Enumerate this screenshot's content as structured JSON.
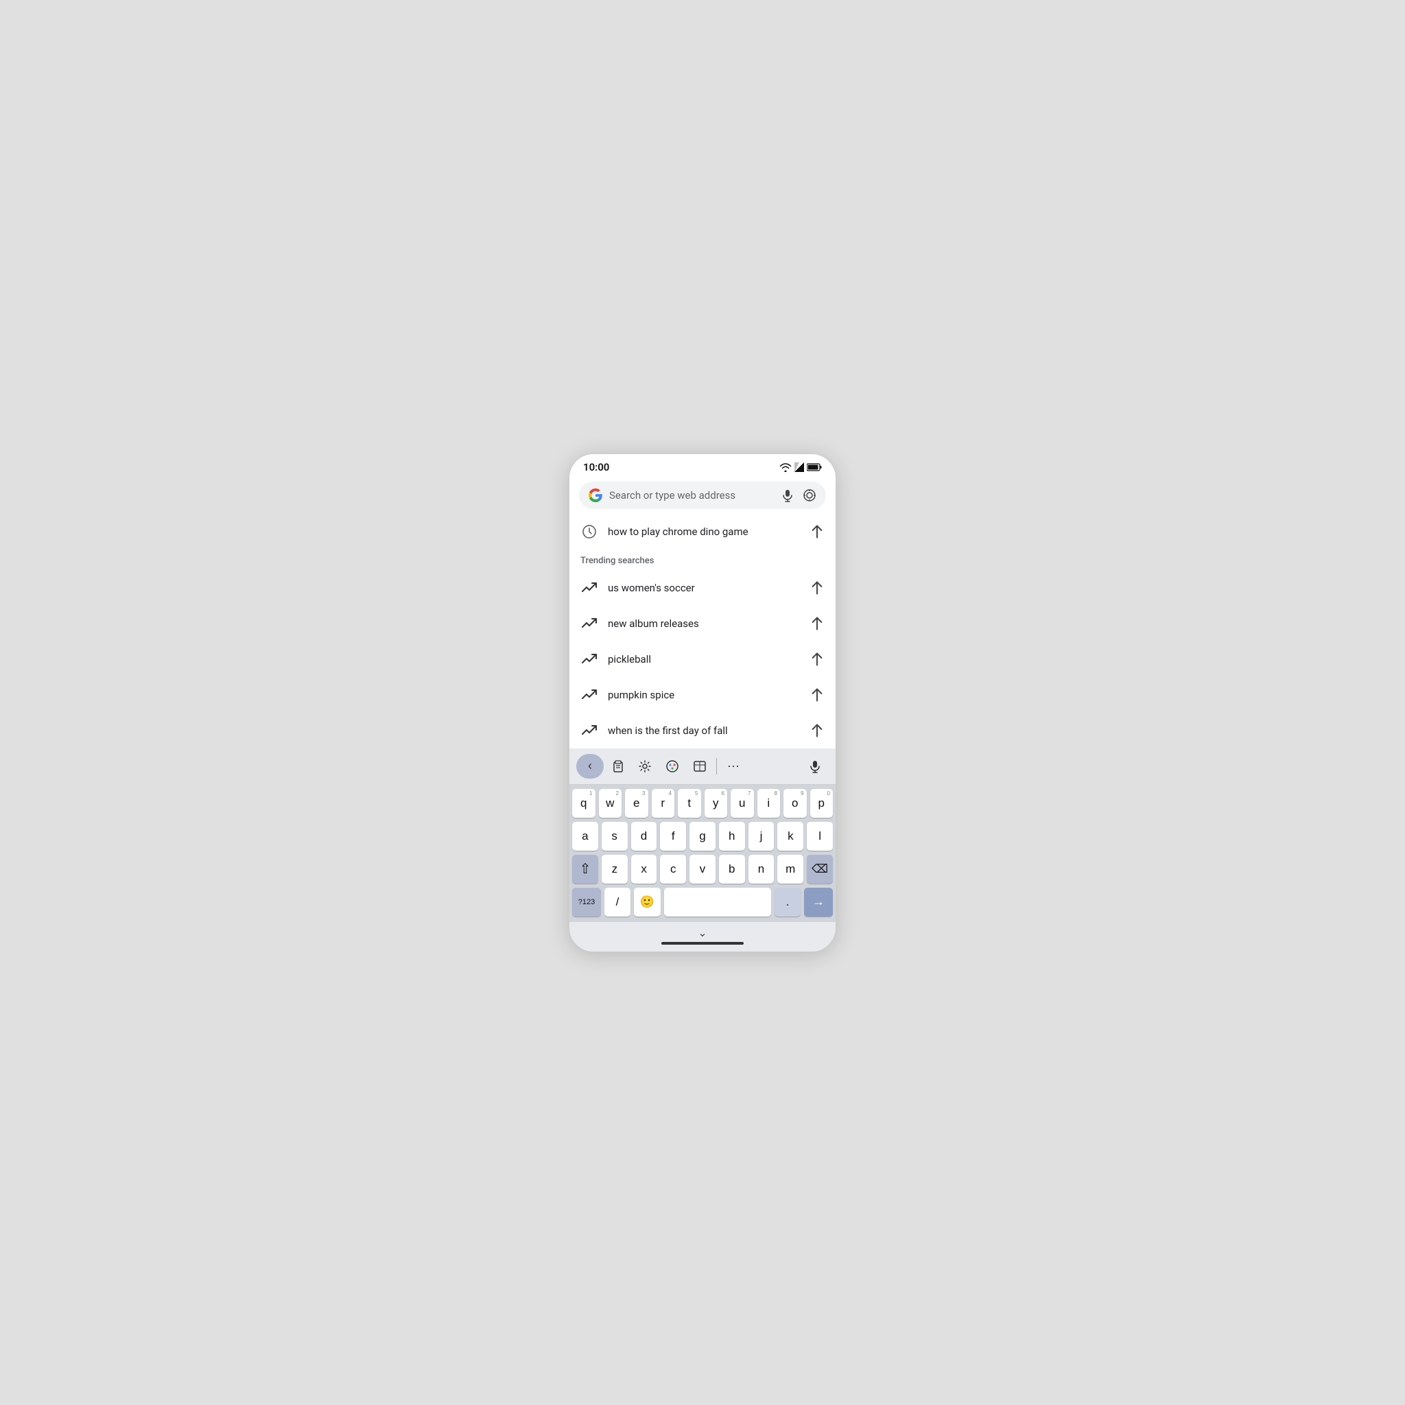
{
  "status": {
    "time": "10:00"
  },
  "search": {
    "placeholder": "Search or type web address"
  },
  "history": {
    "items": [
      {
        "text": "how to play chrome dino game"
      }
    ]
  },
  "trending": {
    "label": "Trending searches",
    "items": [
      {
        "text": "us women's soccer"
      },
      {
        "text": "new album releases"
      },
      {
        "text": "pickleball"
      },
      {
        "text": "pumpkin spice"
      },
      {
        "text": "when is the first day of fall"
      }
    ]
  },
  "keyboard": {
    "toolbar": {
      "back": "‹",
      "clipboard": "📋",
      "settings": "⚙",
      "theme": "🎨",
      "translate": "⊡",
      "more": "···",
      "mic": "🎤"
    },
    "rows": {
      "row1": [
        "q",
        "w",
        "e",
        "r",
        "t",
        "y",
        "u",
        "i",
        "o",
        "p"
      ],
      "row1nums": [
        "1",
        "2",
        "3",
        "4",
        "5",
        "6",
        "7",
        "8",
        "9",
        "0"
      ],
      "row2": [
        "a",
        "s",
        "d",
        "f",
        "g",
        "h",
        "j",
        "k",
        "l"
      ],
      "row3": [
        "z",
        "x",
        "c",
        "v",
        "b",
        "n",
        "m"
      ],
      "num_key": "?123",
      "slash": "/",
      "dot": ".",
      "space": ""
    },
    "arrow_up": "↑",
    "backspace": "⌫",
    "enter_arrow": "→"
  }
}
